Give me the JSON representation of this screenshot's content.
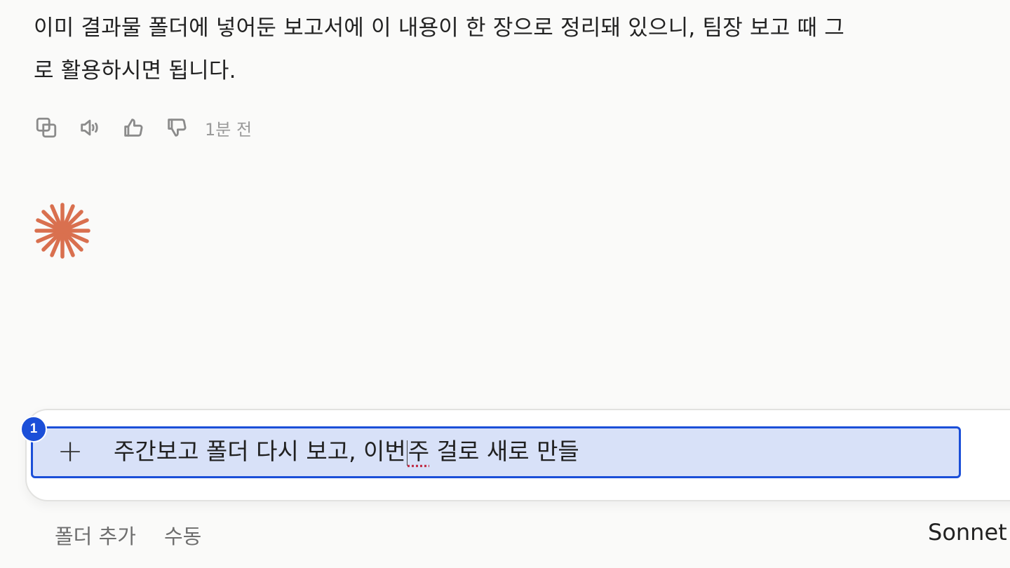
{
  "message": {
    "line1": "이미 결과물 폴더에 넣어둔 보고서에 이 내용이 한 장으로 정리돼 있으니, 팀장 보고 때 그",
    "line2": "로 활용하시면 됩니다."
  },
  "actions": {
    "icons": [
      "copy-icon",
      "speaker-icon",
      "thumbs-up-icon",
      "thumbs-down-icon"
    ],
    "timestamp": "1분 전"
  },
  "logo": {
    "icon": "sparkle-asterisk-icon",
    "color": "#d9704f"
  },
  "composer": {
    "badge": "1",
    "plus_label": "+",
    "input_part1": "주간보고 폴더 다시 보고, 이번",
    "input_part2": "주",
    "input_part3": " 걸로 새로 만들",
    "highlight_color": "#d8e1f8",
    "border_color": "#1b4fd8"
  },
  "bottom": {
    "tool1": "폴더 추가",
    "tool2": "수동",
    "model": "Sonnet"
  }
}
